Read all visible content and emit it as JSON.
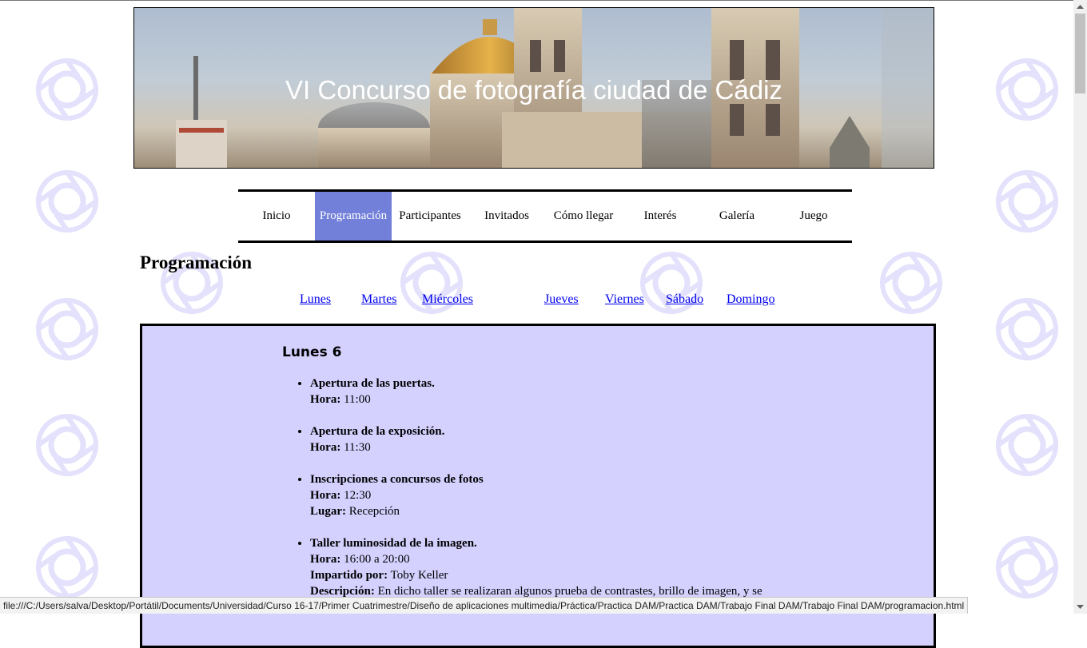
{
  "header": {
    "title": "VI Concurso de fotografía ciudad de Cádiz"
  },
  "nav": {
    "items": [
      "Inicio",
      "Programación",
      "Participantes",
      "Invitados",
      "Cómo llegar",
      "Interés",
      "Galería",
      "Juego"
    ],
    "active": "Programación"
  },
  "page": {
    "title": "Programación"
  },
  "days": [
    "Lunes",
    "Martes",
    "Miércoles",
    "Jueves",
    "Viernes",
    "Sábado",
    "Domingo"
  ],
  "schedule": {
    "day_title": "Lunes 6",
    "events": [
      {
        "name": "Apertura de las puertas.",
        "hora_label": "Hora:",
        "hora": "11:00"
      },
      {
        "name": "Apertura de la exposición.",
        "hora_label": "Hora:",
        "hora": "11:30"
      },
      {
        "name": "Inscripciones a concursos de fotos",
        "hora_label": "Hora:",
        "hora": "12:30",
        "lugar_label": "Lugar:",
        "lugar": "Recepción"
      },
      {
        "name": "Taller luminosidad de la imagen.",
        "hora_label": "Hora:",
        "hora": "16:00 a 20:00",
        "impartido_label": "Impartido por:",
        "impartido": "Toby Keller",
        "descripcion_label": "Descripción:",
        "descripcion": "En dicho taller se realizaran algunos prueba de contrastes, brillo de imagen, y se"
      }
    ]
  },
  "status_bar": {
    "url": "file:///C:/Users/salva/Desktop/Portátil/Documents/Universidad/Curso 16-17/Primer Cuatrimestre/Diseño de aplicaciones multimedia/Práctica/Practica DAM/Practica DAM/Trabajo Final DAM/Trabajo Final DAM/programacion.html"
  },
  "colors": {
    "nav_active": "#7280d9",
    "content_bg": "#d4d0ff",
    "link": "#0000ee",
    "watermark": "#e3e1fb"
  },
  "icons": {
    "watermark": "camera-aperture-icon"
  }
}
